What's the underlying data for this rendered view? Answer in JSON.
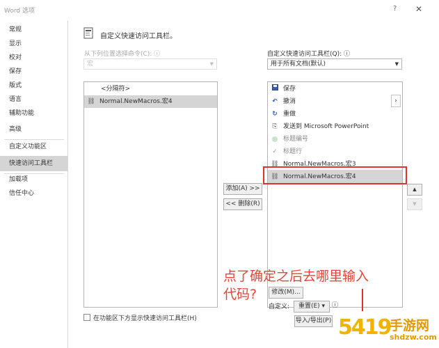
{
  "window": {
    "title": "Word 选项",
    "help": "?",
    "close": "✕"
  },
  "sidebar": {
    "items": [
      {
        "label": "常规"
      },
      {
        "label": "显示"
      },
      {
        "label": "校对"
      },
      {
        "label": "保存"
      },
      {
        "label": "版式"
      },
      {
        "label": "语言"
      },
      {
        "label": "辅助功能"
      },
      {
        "label": "高级"
      },
      {
        "label": "自定义功能区"
      },
      {
        "label": "快速访问工具栏"
      },
      {
        "label": "加载项"
      },
      {
        "label": "信任中心"
      }
    ],
    "selected": "快速访问工具栏"
  },
  "header": {
    "title": "自定义快速访问工具栏。"
  },
  "left": {
    "choose_label": "从下列位置选择命令(C):",
    "choose_value": "宏",
    "items": [
      {
        "label": "<分隔符>",
        "icon": "none"
      },
      {
        "label": "Normal.NewMacros.宏4",
        "icon": "macro-icon"
      }
    ],
    "checkbox_label": "在功能区下方显示快速访问工具栏(H)"
  },
  "middle": {
    "add_label": "添加(A) >>",
    "remove_label": "<< 删除(R)"
  },
  "right": {
    "customize_label": "自定义快速访问工具栏(Q):",
    "customize_value": "用于所有文档(默认)",
    "items": [
      {
        "label": "保存",
        "icon": "save-icon"
      },
      {
        "label": "撤消",
        "icon": "undo-icon"
      },
      {
        "label": "重做",
        "icon": "redo-icon"
      },
      {
        "label": "发送到 Microsoft PowerPoint",
        "icon": "send-icon"
      },
      {
        "label": "标题编号",
        "icon": "circle-icon"
      },
      {
        "label": "标题行",
        "icon": "check-icon"
      },
      {
        "label": "Normal.NewMacros.宏3",
        "icon": "macro-icon"
      },
      {
        "label": "Normal.NewMacros.宏4",
        "icon": "macro-icon"
      }
    ],
    "selected_index": 7,
    "modify_label": "修改(M)...",
    "custom_label": "自定义:",
    "reset_label": "重置(E) ▾",
    "import_export_label": "导入/导出(P)"
  },
  "annotation": {
    "line1": "点了确定之后去哪里输入",
    "line2": "代码?"
  },
  "watermark": {
    "text": "手游网",
    "url": "shdzw.com",
    "num": "5419"
  },
  "colors": {
    "selected_bg": "#d5d5d5",
    "annotation": "#e0463a",
    "watermark": "#f0b400"
  }
}
